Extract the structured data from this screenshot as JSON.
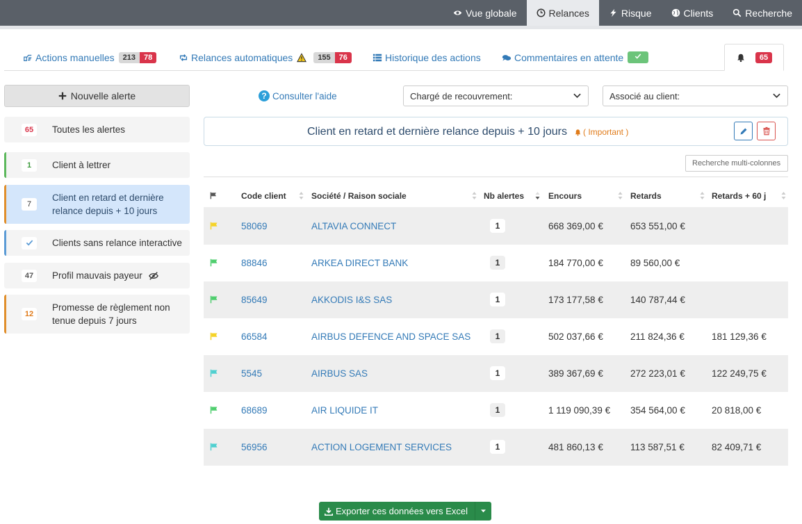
{
  "topnav": {
    "items": [
      {
        "label": "Vue globale",
        "icon": "eye-icon"
      },
      {
        "label": "Relances",
        "icon": "clock-icon",
        "active": true
      },
      {
        "label": "Risque",
        "icon": "bolt-icon"
      },
      {
        "label": "Clients",
        "icon": "globe-icon"
      },
      {
        "label": "Recherche",
        "icon": "search-icon"
      }
    ]
  },
  "tabs": {
    "manual": {
      "label": "Actions manuelles",
      "count_total": "213",
      "count_alert": "78"
    },
    "auto": {
      "label": "Relances automatiques",
      "count_total": "155",
      "count_alert": "76"
    },
    "history": {
      "label": "Historique des actions"
    },
    "comments": {
      "label": "Commentaires en attente"
    },
    "bell": {
      "count": "65"
    }
  },
  "sidebar": {
    "new_alert_label": "Nouvelle alerte",
    "items": [
      {
        "count": "65",
        "label": "Toutes les alertes"
      },
      {
        "count": "1",
        "label": "Client à lettrer"
      },
      {
        "count": "7",
        "label_line1": "Client en retard et dernière",
        "label_line2": "relance depuis + 10 jours"
      },
      {
        "label": "Clients sans relance interactive"
      },
      {
        "count": "47",
        "label": "Profil mauvais payeur"
      },
      {
        "count": "12",
        "label_line1": "Promesse de règlement non",
        "label_line2": "tenue depuis 7 jours"
      }
    ]
  },
  "filters": {
    "help_label": "Consulter l'aide",
    "charge_label": "Chargé de recouvrement:",
    "associe_label": "Associé au client:"
  },
  "panel": {
    "title": "Client en retard et dernière relance depuis + 10 jours",
    "important_label": "( Important )"
  },
  "search": {
    "placeholder": "Recherche multi-colonnes"
  },
  "table": {
    "headers": {
      "code": "Code client",
      "societe": "Société / Raison sociale",
      "nb": "Nb alertes",
      "encours": "Encours",
      "retards": "Retards",
      "retards60": "Retards + 60 j"
    },
    "rows": [
      {
        "flag": "#f5d327",
        "code": "58069",
        "societe": "ALTAVIA CONNECT",
        "nb": "1",
        "encours": "668 369,00 €",
        "retards": "653 551,00 €",
        "retards60": ""
      },
      {
        "flag": "#4fce6e",
        "code": "88846",
        "societe": "ARKEA DIRECT BANK",
        "nb": "1",
        "encours": "184 770,00 €",
        "retards": "89 560,00 €",
        "retards60": ""
      },
      {
        "flag": "#4fce6e",
        "code": "85649",
        "societe": "AKKODIS I&S SAS",
        "nb": "1",
        "encours": "173 177,58 €",
        "retards": "140 787,44 €",
        "retards60": ""
      },
      {
        "flag": "#f5d327",
        "code": "66584",
        "societe": "AIRBUS DEFENCE AND SPACE SAS",
        "nb": "1",
        "encours": "502 037,66 €",
        "retards": "211 824,36 €",
        "retards60": "181 129,36 €"
      },
      {
        "flag": "#4fd0d0",
        "code": "5545",
        "societe": "AIRBUS SAS",
        "nb": "1",
        "encours": "389 367,69 €",
        "retards": "272 223,01 €",
        "retards60": "122 249,75 €"
      },
      {
        "flag": "#4fce6e",
        "code": "68689",
        "societe": "AIR LIQUIDE IT",
        "nb": "1",
        "encours": "1 119 090,39 €",
        "retards": "354 564,00 €",
        "retards60": "20 818,00 €"
      },
      {
        "flag": "#4fd0d0",
        "code": "56956",
        "societe": "ACTION LOGEMENT SERVICES",
        "nb": "1",
        "encours": "481 860,13 €",
        "retards": "113 587,51 €",
        "retards60": "82 409,71 €"
      }
    ]
  },
  "export": {
    "label": "Exporter ces données vers Excel"
  },
  "colors": {
    "accent": "#337ab7",
    "danger": "#d9344a",
    "success": "#2a8b4a",
    "warning": "#e07b1a"
  }
}
